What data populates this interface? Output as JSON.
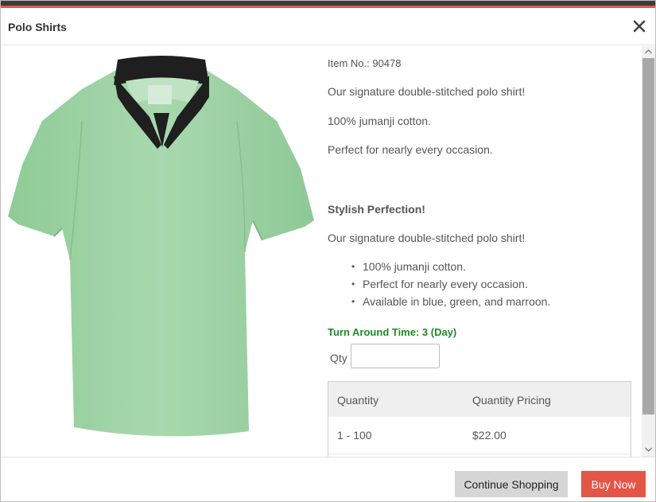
{
  "colors": {
    "accent": "#e35546",
    "header_strip": "#3b3b3b",
    "turnaround_text": "#1f8a25",
    "shirt": "#a3d6a9",
    "collar": "#1e1e1e"
  },
  "modal": {
    "title": "Polo Shirts",
    "close_icon": "close-icon"
  },
  "product": {
    "image_alt": "green-polo-shirt",
    "item_no": "Item No.: 90478",
    "paragraphs": [
      "Our signature double-stitched polo shirt!",
      "100% jumanji cotton.",
      "Perfect for nearly every occasion."
    ],
    "subtitle": "Stylish Perfection!",
    "subtitle_paragraph": "Our signature double-stitched polo shirt!",
    "bullets": [
      "100% jumanji cotton.",
      "Perfect for nearly every occasion.",
      "Available in blue, green, and marroon."
    ],
    "bullet_char": "•",
    "turnaround": "Turn Around Time: 3 (Day)",
    "qty_label": "Qty",
    "qty_value": ""
  },
  "pricing_table": {
    "headers": [
      "Quantity",
      "Quantity Pricing"
    ],
    "rows": [
      [
        "1 - 100",
        "$22.00"
      ]
    ]
  },
  "footer": {
    "continue_label": "Continue Shopping",
    "buy_label": "Buy Now"
  }
}
